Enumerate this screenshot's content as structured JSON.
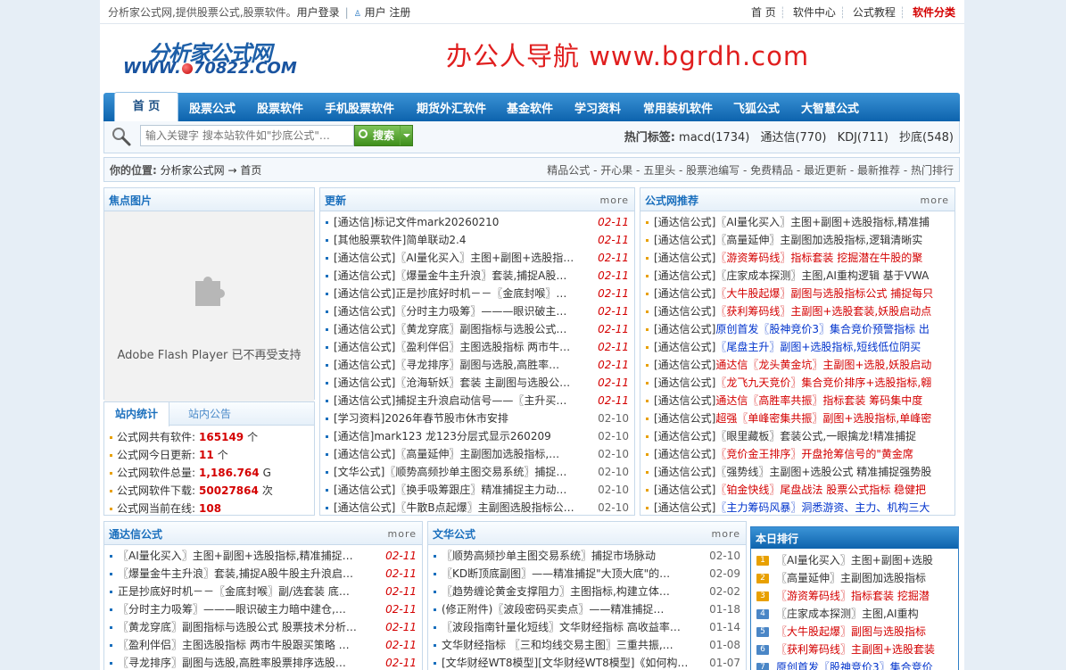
{
  "topbar": {
    "intro": "分析家公式网,提供股票公式,股票软件。",
    "login": "用户登录",
    "register": "用户 注册",
    "links": [
      "首 页",
      "软件中心",
      "公式教程"
    ],
    "hot_link": "软件分类"
  },
  "logo": {
    "line1": "分析家公式网",
    "line2_pre": "WWW.",
    "line2_post": "70822.COM"
  },
  "banner": "办公人导航  www.bgrdh.com",
  "nav": {
    "home": "首 页",
    "items": [
      "股票公式",
      "股票软件",
      "手机股票软件",
      "期货外汇软件",
      "基金软件",
      "学习资料",
      "常用装机软件",
      "飞狐公式",
      "大智慧公式"
    ]
  },
  "search": {
    "placeholder": "输入关键字 搜本站软件如\"抄底公式\"…",
    "button": "搜索",
    "hot_label": "热门标签:",
    "hot_tags": [
      "macd(1734)",
      "通达信(770)",
      "KDJ(711)",
      "抄底(548)"
    ]
  },
  "crumb": {
    "label": "你的位置:",
    "path": "分析家公式网 → 首页",
    "links": "精品公式 - 开心果 - 五里头 - 股票池编写 - 免费精品 - 最近更新 - 最新推荐 - 热门排行"
  },
  "focus": {
    "title": "焦点图片",
    "flash_msg": "Adobe Flash Player 已不再受支持"
  },
  "stats": {
    "tab1": "站内统计",
    "tab2": "站内公告",
    "rows": [
      {
        "label": "公式网共有软件:",
        "value": "165149",
        "unit": "个"
      },
      {
        "label": "公式网今日更新:",
        "value": "11",
        "unit": "个"
      },
      {
        "label": "公式网软件总量:",
        "value": "1,186.764",
        "unit": "G"
      },
      {
        "label": "公式网软件下载:",
        "value": "50027864",
        "unit": "次"
      },
      {
        "label": "公式网当前在线:",
        "value": "108",
        "unit": ""
      }
    ]
  },
  "updates": {
    "title": "更新",
    "more": "more",
    "items": [
      {
        "text": "[通达信]标记文件mark20260210",
        "date": "02-11",
        "new": true
      },
      {
        "text": "[其他股票软件]简单联动2.4",
        "date": "02-11",
        "new": true
      },
      {
        "text": "[通达信公式]〖AI量化买入〗主图+副图+选股指…",
        "date": "02-11",
        "new": true
      },
      {
        "text": "[通达信公式]〖爆量金牛主升浪〗套装,捕捉A股…",
        "date": "02-11",
        "new": true
      },
      {
        "text": "[通达信公式]正是抄底好时机－－〖金底封喉〗…",
        "date": "02-11",
        "new": true
      },
      {
        "text": "[通达信公式]〖分时主力吸筹〗———眼识破主…",
        "date": "02-11",
        "new": true
      },
      {
        "text": "[通达信公式]〖黄龙穿底〗副图指标与选股公式…",
        "date": "02-11",
        "new": true
      },
      {
        "text": "[通达信公式]〖盈利伴侣〗主图选股指标 两市牛…",
        "date": "02-11",
        "new": true
      },
      {
        "text": "[通达信公式]〖寻龙排序〗副图与选股,高胜率…",
        "date": "02-11",
        "new": true
      },
      {
        "text": "[通达信公式]〖沧海斩妖〗套装 主副图与选股公…",
        "date": "02-11",
        "new": true
      },
      {
        "text": "[通达信公式]捕捉主升浪启动信号——〖主升买…",
        "date": "02-11",
        "new": true
      },
      {
        "text": "[学习资料]2026年春节股市休市安排",
        "date": "02-10",
        "new": false
      },
      {
        "text": "[通达信]mark123 龙123分层式显示260209",
        "date": "02-10",
        "new": false
      },
      {
        "text": "[通达信公式]〖高量延伸〗主副图加选股指标,…",
        "date": "02-10",
        "new": false
      },
      {
        "text": "[文华公式]〖顺势高频抄单主图交易系统〗捕捉…",
        "date": "02-10",
        "new": false
      },
      {
        "text": "[通达信公式]〖换手吸筹跟庄〗精准捕捉主力动…",
        "date": "02-10",
        "new": false
      },
      {
        "text": "[通达信公式]〖牛散B点起爆〗主副图选股指标公…",
        "date": "02-10",
        "new": false
      }
    ]
  },
  "recommend": {
    "title": "公式网推荐",
    "more": "more",
    "items": [
      {
        "pre": "[通达信公式]",
        "text": "〖AI量化买入〗主图+副图+选股指标,精准捕",
        "color": ""
      },
      {
        "pre": "[通达信公式]",
        "text": "〖高量延伸〗主副图加选股指标,逻辑清晰实",
        "color": ""
      },
      {
        "pre": "[通达信公式]",
        "text": "〖游资筹码线〗指标套装 挖掘潜在牛股的聚",
        "color": "red"
      },
      {
        "pre": "[通达信公式]",
        "text": "〖庄家成本探测〗主图,AI重构逻辑 基于VWA",
        "color": ""
      },
      {
        "pre": "[通达信公式]",
        "text": "〖大牛股起爆〗副图与选股指标公式 捕捉每只",
        "color": "red"
      },
      {
        "pre": "[通达信公式]",
        "text": "〖获利筹码线〗主副图+选股套装,妖股启动点",
        "color": "red"
      },
      {
        "pre": "[通达信公式]",
        "text": "原创首发〖股神竞价3〗集合竞价预警指标 出",
        "color": "blue"
      },
      {
        "pre": "[通达信公式]",
        "text": "〖尾盘主升〗副图+选股指标,短线低位阴买",
        "color": "blue"
      },
      {
        "pre": "[通达信公式]",
        "text": "通达信〖龙头黄金坑〗主副图+选股,妖股启动",
        "color": "red"
      },
      {
        "pre": "[通达信公式]",
        "text": "〖龙飞九天竞价〗集合竞价排序+选股指标,翱",
        "color": "red"
      },
      {
        "pre": "[通达信公式]",
        "text": "通达信〖高胜率共振〗指标套装 筹码集中度",
        "color": "red"
      },
      {
        "pre": "[通达信公式]",
        "text": "超强〖单峰密集共振〗副图+选股指标,单峰密",
        "color": "red"
      },
      {
        "pre": "[通达信公式]",
        "text": "〖眼里藏板〗套装公式,一眼擒龙!精准捕捉",
        "color": ""
      },
      {
        "pre": "[通达信公式]",
        "text": "〖竞价金王排序〗开盘抢筹信号的\"黄金席",
        "color": "red"
      },
      {
        "pre": "[通达信公式]",
        "text": "〖强势线〗主副图+选股公式 精准捕捉强势股",
        "color": ""
      },
      {
        "pre": "[通达信公式]",
        "text": "〖铂金快线〗尾盘战法 股票公式指标 稳健把",
        "color": "red"
      },
      {
        "pre": "[通达信公式]",
        "text": "〖主力筹码风暴〗洞悉游资、主力、机构三大",
        "color": "blue"
      }
    ]
  },
  "tdx": {
    "title": "通达信公式",
    "more": "more",
    "items": [
      {
        "text": "〖AI量化买入〗主图+副图+选股指标,精准捕捉…",
        "date": "02-11",
        "new": true
      },
      {
        "text": "〖爆量金牛主升浪〗套装,捕捉A股牛股主升浪启…",
        "date": "02-11",
        "new": true
      },
      {
        "text": "正是抄底好时机－－〖金底封喉〗副/选套装 底…",
        "date": "02-11",
        "new": true
      },
      {
        "text": "〖分时主力吸筹〗———眼识破主力暗中建仓,…",
        "date": "02-11",
        "new": true
      },
      {
        "text": "〖黄龙穿底〗副图指标与选股公式 股票技术分析…",
        "date": "02-11",
        "new": true
      },
      {
        "text": "〖盈利伴侣〗主图选股指标 两市牛股跟买策略 …",
        "date": "02-11",
        "new": true
      },
      {
        "text": "〖寻龙排序〗副图与选股,高胜率股票排序选股…",
        "date": "02-11",
        "new": true
      }
    ]
  },
  "wenhua": {
    "title": "文华公式",
    "more": "more",
    "items": [
      {
        "text": "〖顺势高频抄单主图交易系统〗捕捉市场脉动",
        "date": "02-10"
      },
      {
        "text": "〖KD断顶底副图〗——精准捕捉\"大顶大底\"的…",
        "date": "02-09"
      },
      {
        "text": "〖趋势缠论黄金支撑阻力〗主图指标,构建立体…",
        "date": "02-02"
      },
      {
        "text": "(修正附件)〖波段密码买卖点〗——精准捕捉…",
        "date": "01-18"
      },
      {
        "text": "〖波段指南针量化短线〗文华财经指标 高收益率…",
        "date": "01-14"
      },
      {
        "text": "文华财经指标 〖三和均线交易主图〗三重共振,…",
        "date": "01-08"
      },
      {
        "text": "[文华财经WT8模型][文华财经WT8模型]《如何构…",
        "date": "01-07"
      }
    ]
  },
  "rank": {
    "title": "本日排行",
    "items": [
      {
        "n": "1",
        "text": "〖AI量化买入〗主图+副图+选股",
        "color": "",
        "bg": "#e8a000"
      },
      {
        "n": "2",
        "text": "〖高量延伸〗主副图加选股指标",
        "color": "",
        "bg": "#e8a000"
      },
      {
        "n": "3",
        "text": "〖游资筹码线〗指标套装 挖掘潜",
        "color": "red",
        "bg": "#e8a000"
      },
      {
        "n": "4",
        "text": "〖庄家成本探测〗主图,AI重构",
        "color": "",
        "bg": "#4a86c6"
      },
      {
        "n": "5",
        "text": "〖大牛股起爆〗副图与选股指标",
        "color": "red",
        "bg": "#4a86c6"
      },
      {
        "n": "6",
        "text": "〖获利筹码线〗主副图+选股套装",
        "color": "red",
        "bg": "#4a86c6"
      },
      {
        "n": "7",
        "text": "原创首发〖股神竞价3〗集合竞价",
        "color": "blue",
        "bg": "#4a86c6"
      }
    ]
  }
}
